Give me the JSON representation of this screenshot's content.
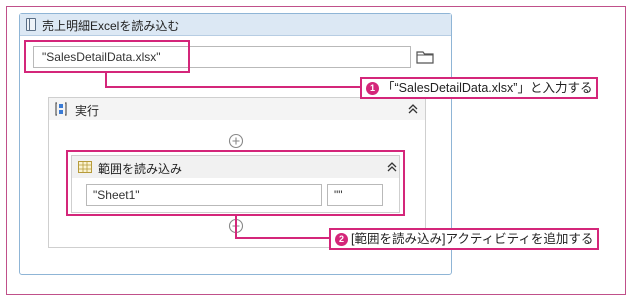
{
  "activity": {
    "title": "売上明細Excelを読み込む",
    "file_path": "\"SalesDetailData.xlsx\""
  },
  "sequence": {
    "title": "実行"
  },
  "read_range": {
    "title": "範囲を読み込み",
    "sheet": "\"Sheet1\"",
    "range": "\"\""
  },
  "callouts": [
    {
      "number": "1",
      "text": "「“SalesDetailData.xlsx”」と入力する"
    },
    {
      "number": "2",
      "text": "[範囲を読み込み]アクティビティを追加する"
    }
  ],
  "colors": {
    "accent": "#d4267a",
    "header": "#dce8f4",
    "frame": "#8fb5d6"
  },
  "icons": [
    "book-icon",
    "folder-icon",
    "sequence-icon",
    "collapse-icon",
    "add-activity-icon",
    "spreadsheet-icon"
  ]
}
